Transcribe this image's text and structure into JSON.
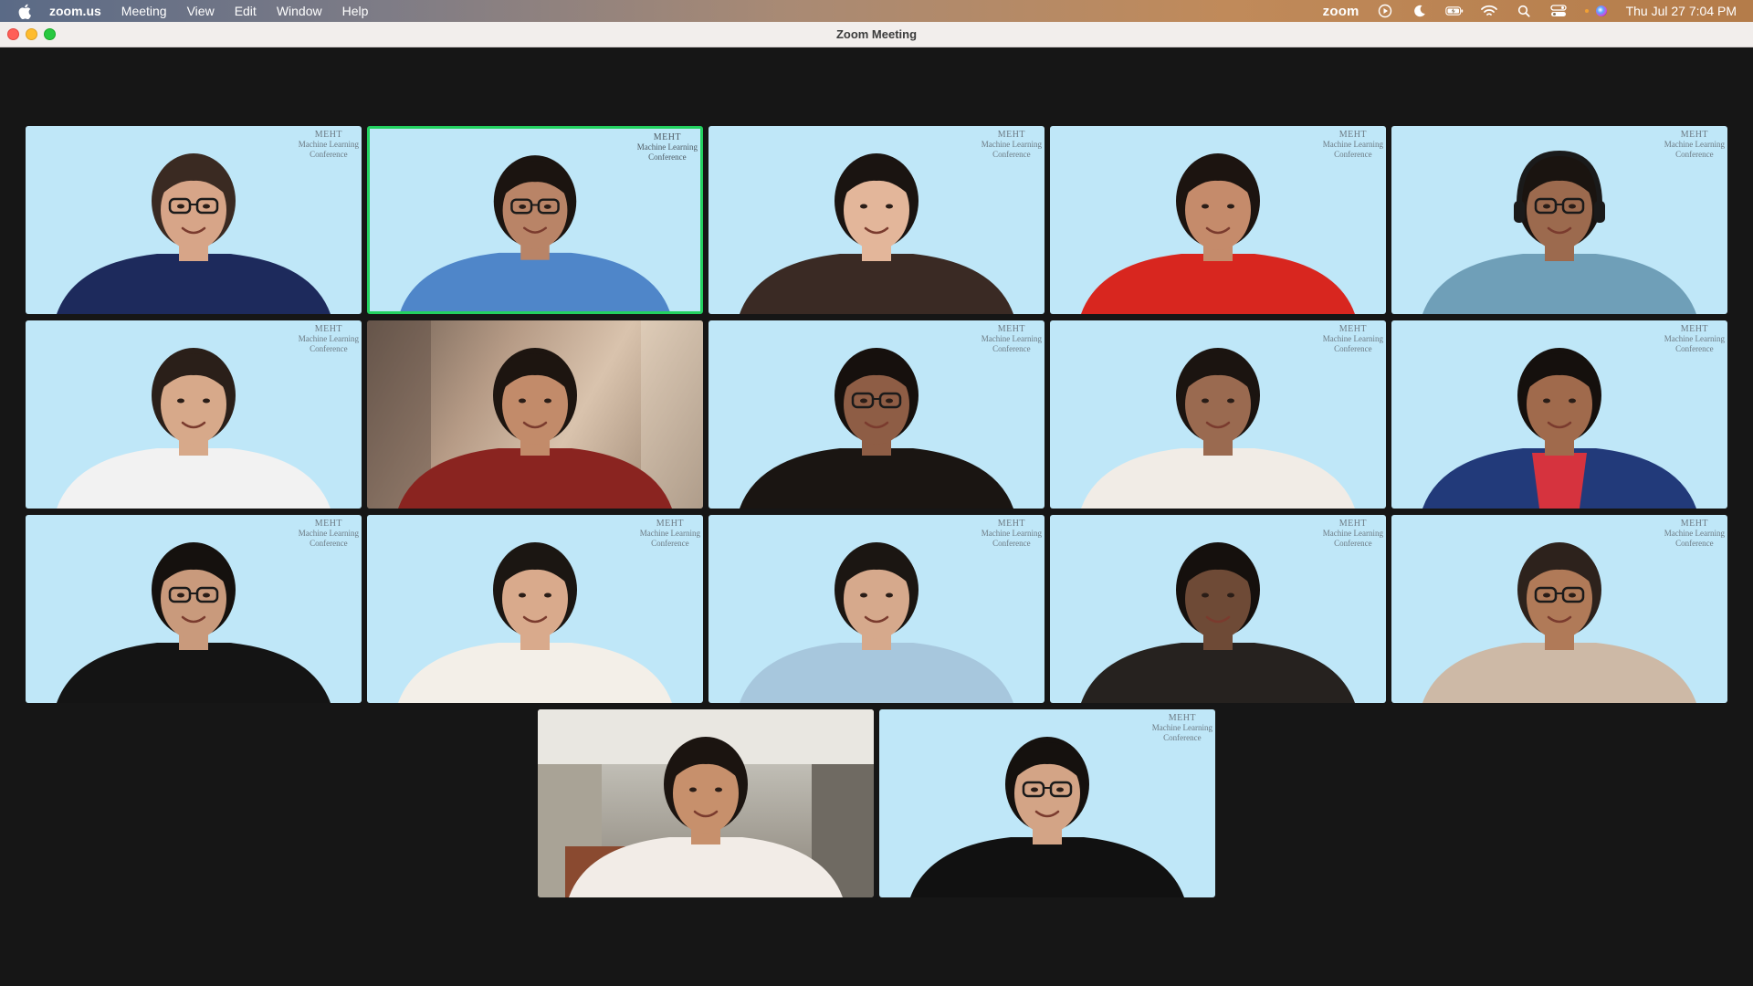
{
  "menubar": {
    "apple_icon": "apple-logo-icon",
    "app_name": "zoom.us",
    "menus": [
      "Meeting",
      "View",
      "Edit",
      "Window",
      "Help"
    ],
    "status": {
      "zoom_label": "zoom",
      "icons": [
        "play-circle-icon",
        "moon-icon",
        "battery-icon",
        "wifi-icon",
        "search-icon",
        "control-center-icon",
        "siri-icon"
      ],
      "datetime": "Thu Jul 27  7:04 PM"
    }
  },
  "window": {
    "title": "Zoom Meeting"
  },
  "watermark": {
    "line1": "MEHT",
    "line2": "Machine Learning",
    "line3": "Conference"
  },
  "colors": {
    "active_speaker_border": "#23d160",
    "virtual_background": "#bfe7f8",
    "gallery_background": "#161616"
  },
  "participants": [
    {
      "skin": "#d7a588",
      "hair": "#3a2a22",
      "shirt": "#1d2a5c",
      "glasses": true,
      "bg": "blue",
      "speaking": false
    },
    {
      "skin": "#b98467",
      "hair": "#1b1410",
      "shirt": "#4f86c9",
      "glasses": true,
      "bg": "blue",
      "speaking": true
    },
    {
      "skin": "#e3b69a",
      "hair": "#1a1411",
      "shirt": "#3a2a24",
      "glasses": false,
      "bg": "blue",
      "speaking": false
    },
    {
      "skin": "#c58b6b",
      "hair": "#1c1410",
      "shirt": "#d8261f",
      "glasses": false,
      "bg": "blue",
      "speaking": false
    },
    {
      "skin": "#9c6a4e",
      "hair": "#1a1410",
      "shirt": "#6f9fb8",
      "glasses": true,
      "bg": "blue",
      "speaking": false,
      "headphones": true
    },
    {
      "skin": "#d7a98a",
      "hair": "#2a1f19",
      "shirt": "#f2f2f2",
      "glasses": false,
      "bg": "blue",
      "speaking": false
    },
    {
      "skin": "#c28b6a",
      "hair": "#1d1510",
      "shirt": "#8a2420",
      "glasses": false,
      "bg": "room",
      "speaking": false
    },
    {
      "skin": "#8e5d45",
      "hair": "#16100d",
      "shirt": "#1a1512",
      "glasses": true,
      "bg": "blue",
      "speaking": false
    },
    {
      "skin": "#9a6a50",
      "hair": "#1b1410",
      "shirt": "#f1ece6",
      "glasses": false,
      "bg": "blue",
      "speaking": false
    },
    {
      "skin": "#a06a4c",
      "hair": "#15100d",
      "shirt": "#223a7a",
      "glasses": false,
      "bg": "blue",
      "speaking": false,
      "inner_shirt": "#d6333e"
    },
    {
      "skin": "#c99a7c",
      "hair": "#15110e",
      "shirt": "#141414",
      "glasses": true,
      "bg": "blue",
      "speaking": false
    },
    {
      "skin": "#d9aa8c",
      "hair": "#1b1612",
      "shirt": "#f3efe8",
      "glasses": false,
      "bg": "blue",
      "speaking": false
    },
    {
      "skin": "#d6a98c",
      "hair": "#1b1612",
      "shirt": "#a7c7dd",
      "glasses": false,
      "bg": "blue",
      "speaking": false
    },
    {
      "skin": "#6e4a36",
      "hair": "#15100d",
      "shirt": "#26221f",
      "glasses": false,
      "bg": "blue",
      "speaking": false
    },
    {
      "skin": "#b07a58",
      "hair": "#2d221c",
      "shirt": "#cdb9a6",
      "glasses": true,
      "bg": "blue",
      "speaking": false
    },
    {
      "skin": "#c7906c",
      "hair": "#1b1410",
      "shirt": "#f2ece7",
      "glasses": false,
      "bg": "room2",
      "speaking": false
    },
    {
      "skin": "#d3a486",
      "hair": "#15110e",
      "shirt": "#111111",
      "glasses": true,
      "bg": "blue",
      "speaking": false
    }
  ]
}
